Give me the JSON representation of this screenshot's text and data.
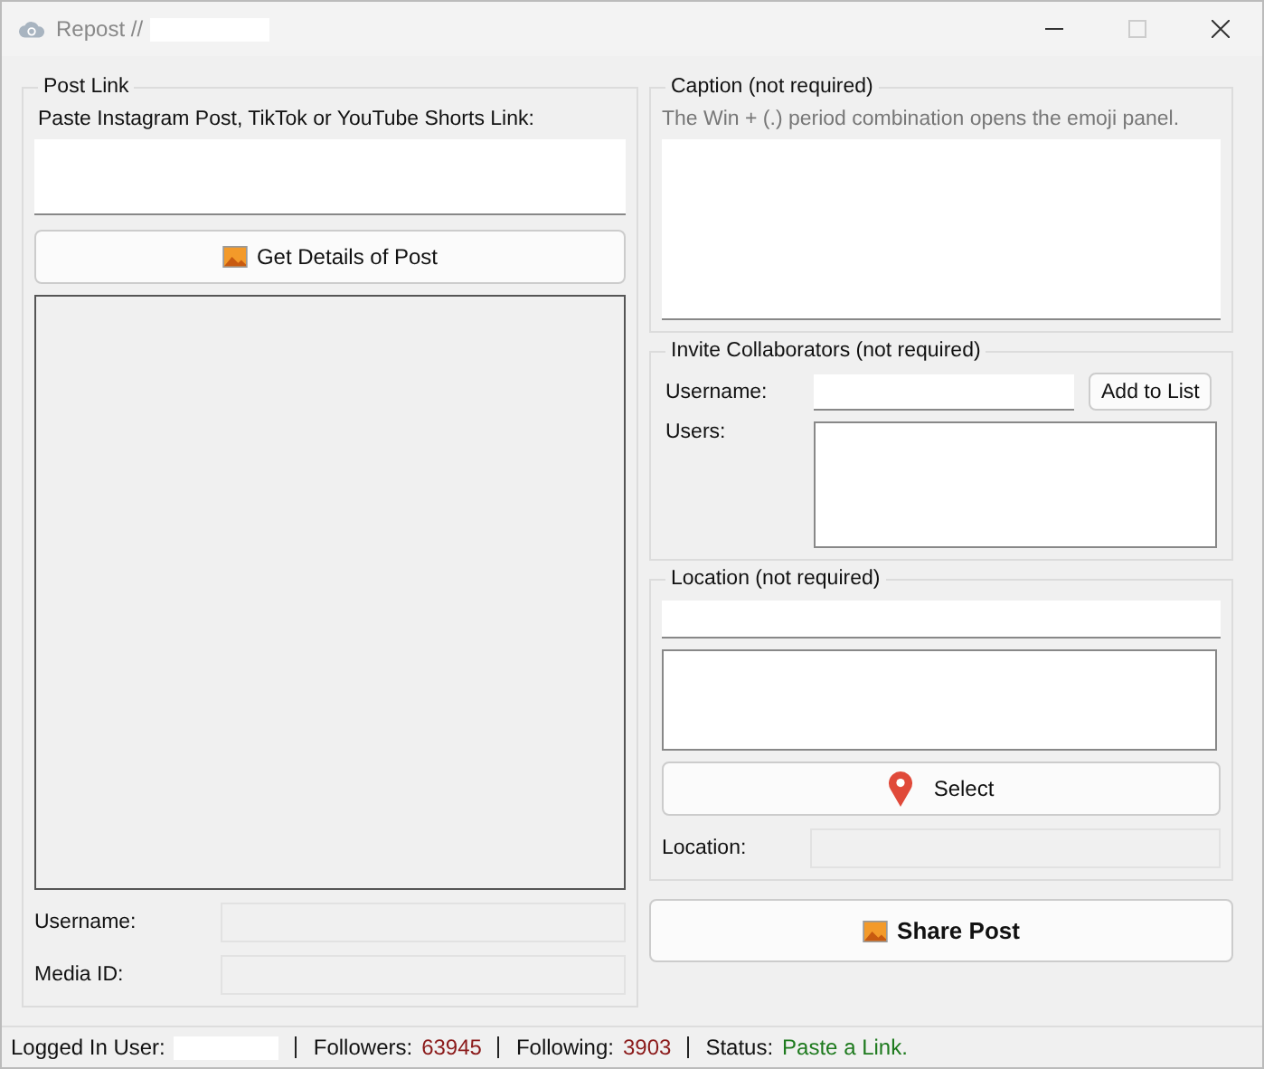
{
  "window": {
    "title": "Repost //"
  },
  "post_link": {
    "legend": "Post Link",
    "prompt": "Paste Instagram Post, TikTok or YouTube Shorts Link:",
    "button": "Get Details of Post",
    "fields": [
      {
        "label": "Username:"
      },
      {
        "label": "Media ID:"
      }
    ]
  },
  "caption": {
    "legend": "Caption (not required)",
    "hint": "The Win + (.) period combination opens the emoji panel."
  },
  "collaborators": {
    "legend": "Invite Collaborators (not required)",
    "username_label": "Username:",
    "add_button": "Add to List",
    "users_label": "Users:"
  },
  "location": {
    "legend": "Location (not required)",
    "button": "Select",
    "location_label": "Location:"
  },
  "share_button": "Share Post",
  "status_bar": {
    "user_label": "Logged In User:",
    "followers_label": "Followers:",
    "followers": "63945",
    "following_label": "Following:",
    "following": "3903",
    "status_label": "Status:",
    "status": "Paste a Link."
  }
}
